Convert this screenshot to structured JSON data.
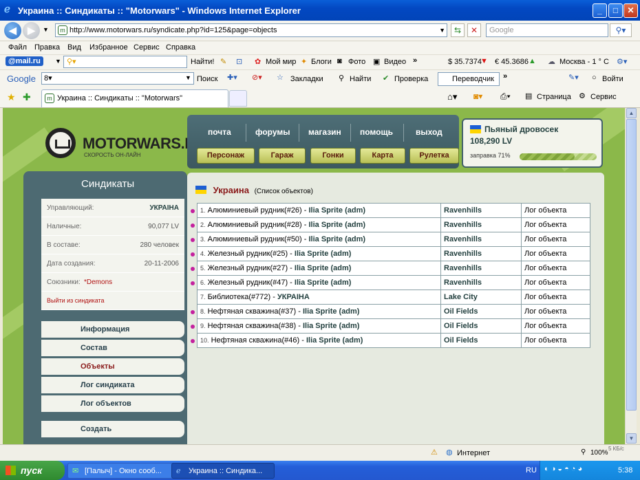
{
  "window": {
    "title": "Украина :: Синдикаты :: \"Motorwars\" - Windows Internet Explorer"
  },
  "address": {
    "url": "http://www.motorwars.ru/syndicate.php?id=125&page=objects",
    "search_placeholder": "Google"
  },
  "menu": [
    "Файл",
    "Правка",
    "Вид",
    "Избранное",
    "Сервис",
    "Справка"
  ],
  "mailbar": {
    "brand": "@mail.ru",
    "find": "Найти!",
    "links": [
      "Мой мир",
      "Блоги",
      "Фото",
      "Видео"
    ],
    "usd": "$ 35.7374",
    "eur": "€ 45.3686",
    "weather": "Москва - 1 ° C"
  },
  "googlebar": {
    "brand": "Google",
    "search": "Поиск",
    "bookmarks": "Закладки",
    "find": "Найти",
    "check": "Проверка",
    "translate": "Переводчик",
    "login": "Войти"
  },
  "tab": {
    "label": "Украина :: Синдикаты :: \"Motorwars\""
  },
  "cmdbar": {
    "page": "Страница",
    "tools": "Сервис"
  },
  "site": {
    "logo": "MOTORWARS.RU",
    "logo_sub": "СКОРОСТЬ ОН-ЛАЙН",
    "nav": [
      "почта",
      "форумы",
      "магазин",
      "помощь",
      "выход"
    ],
    "buttons": [
      "Персонаж",
      "Гараж",
      "Гонки",
      "Карта",
      "Рулетка"
    ],
    "user": {
      "name": "Пьяный дровосек",
      "money": "108,290 LV",
      "fuel_label": "заправка 71%",
      "fuel": 0.71
    }
  },
  "sidebar": {
    "title": "Синдикаты",
    "info": [
      {
        "label": "Управляющий:",
        "value": "УКРАІНА"
      },
      {
        "label": "Наличные:",
        "value": "90,077 LV"
      },
      {
        "label": "В составе:",
        "value": "280 человек"
      },
      {
        "label": "Дата создания:",
        "value": "20-11-2006"
      },
      {
        "label": "Союзники:",
        "value": "*Demons"
      }
    ],
    "leave": "Выйти из синдиката",
    "menu": [
      "Информация",
      "Состав",
      "Объекты",
      "Лог синдиката",
      "Лог объектов"
    ],
    "create": "Создать"
  },
  "main": {
    "title": "Украина",
    "subtitle": "(Список объектов)",
    "rows": [
      {
        "n": "1.",
        "obj": "Алюминиевый рудник(#26) - ",
        "owner": "Ilia Sprite (adm)",
        "loc": "Ravenhills",
        "log": "Лог объекта",
        "bullet": true
      },
      {
        "n": "2.",
        "obj": "Алюминиевый рудник(#28) - ",
        "owner": "Ilia Sprite (adm)",
        "loc": "Ravenhills",
        "log": "Лог объекта",
        "bullet": true
      },
      {
        "n": "3.",
        "obj": "Алюминиевый рудник(#50) - ",
        "owner": "Ilia Sprite (adm)",
        "loc": "Ravenhills",
        "log": "Лог объекта",
        "bullet": true
      },
      {
        "n": "4.",
        "obj": "Железный рудник(#25) - ",
        "owner": "Ilia Sprite (adm)",
        "loc": "Ravenhills",
        "log": "Лог объекта",
        "bullet": true
      },
      {
        "n": "5.",
        "obj": "Железный рудник(#27) - ",
        "owner": "Ilia Sprite (adm)",
        "loc": "Ravenhills",
        "log": "Лог объекта",
        "bullet": true
      },
      {
        "n": "6.",
        "obj": "Железный рудник(#47) - ",
        "owner": "Ilia Sprite (adm)",
        "loc": "Ravenhills",
        "log": "Лог объекта",
        "bullet": true
      },
      {
        "n": "7.",
        "obj": "Библиотека(#772) - ",
        "owner": "УКРАІНА",
        "loc": "Lake City",
        "log": "Лог объекта",
        "bullet": false
      },
      {
        "n": "8.",
        "obj": "Нефтяная скважина(#37) - ",
        "owner": "Ilia Sprite (adm)",
        "loc": "Oil Fields",
        "log": "Лог объекта",
        "bullet": true
      },
      {
        "n": "9.",
        "obj": "Нефтяная скважина(#38) - ",
        "owner": "Ilia Sprite (adm)",
        "loc": "Oil Fields",
        "log": "Лог объекта",
        "bullet": true
      },
      {
        "n": "10.",
        "obj": "Нефтяная скважина(#46) - ",
        "owner": "Ilia Sprite (adm)",
        "loc": "Oil Fields",
        "log": "Лог объекта",
        "bullet": true
      }
    ]
  },
  "status": {
    "zone": "Интернет",
    "zoom": "100%",
    "speed": "5 КБ/с"
  },
  "taskbar": {
    "start": "пуск",
    "tasks": [
      "[Палыч] - Окно сооб...",
      "Украина :: Синдика..."
    ],
    "lang": "RU",
    "time": "5:38"
  },
  "colors": {
    "accent": "#8bb84a",
    "panel": "#4d6a72",
    "bullet": "#c4209e"
  }
}
